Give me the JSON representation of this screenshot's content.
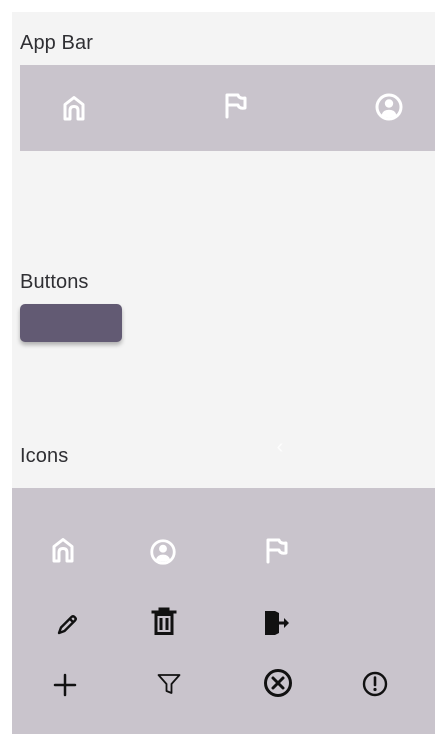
{
  "sections": {
    "app_bar_title": "App Bar",
    "buttons_title": "Buttons",
    "icons_title": "Icons"
  },
  "app_bar": {
    "background": "#c9c4cc",
    "icons": [
      "home-icon",
      "flag-icon",
      "account-icon"
    ],
    "icon_color": "#ffffff"
  },
  "buttons": {
    "primary_label": "",
    "primary_color": "#625a73"
  },
  "icons_panel": {
    "background": "#c9c4cc",
    "icons": [
      "home-icon",
      "account-icon",
      "flag-icon",
      "pencil-icon",
      "trash-icon",
      "exit-door-icon",
      "plus-icon",
      "filter-icon",
      "cancel-circle-icon",
      "alert-circle-icon"
    ],
    "dark_icon_color": "#111111",
    "light_icon_color": "#ffffff"
  },
  "colors": {
    "canvas": "#f4f4f4",
    "text": "#2f2f33"
  }
}
